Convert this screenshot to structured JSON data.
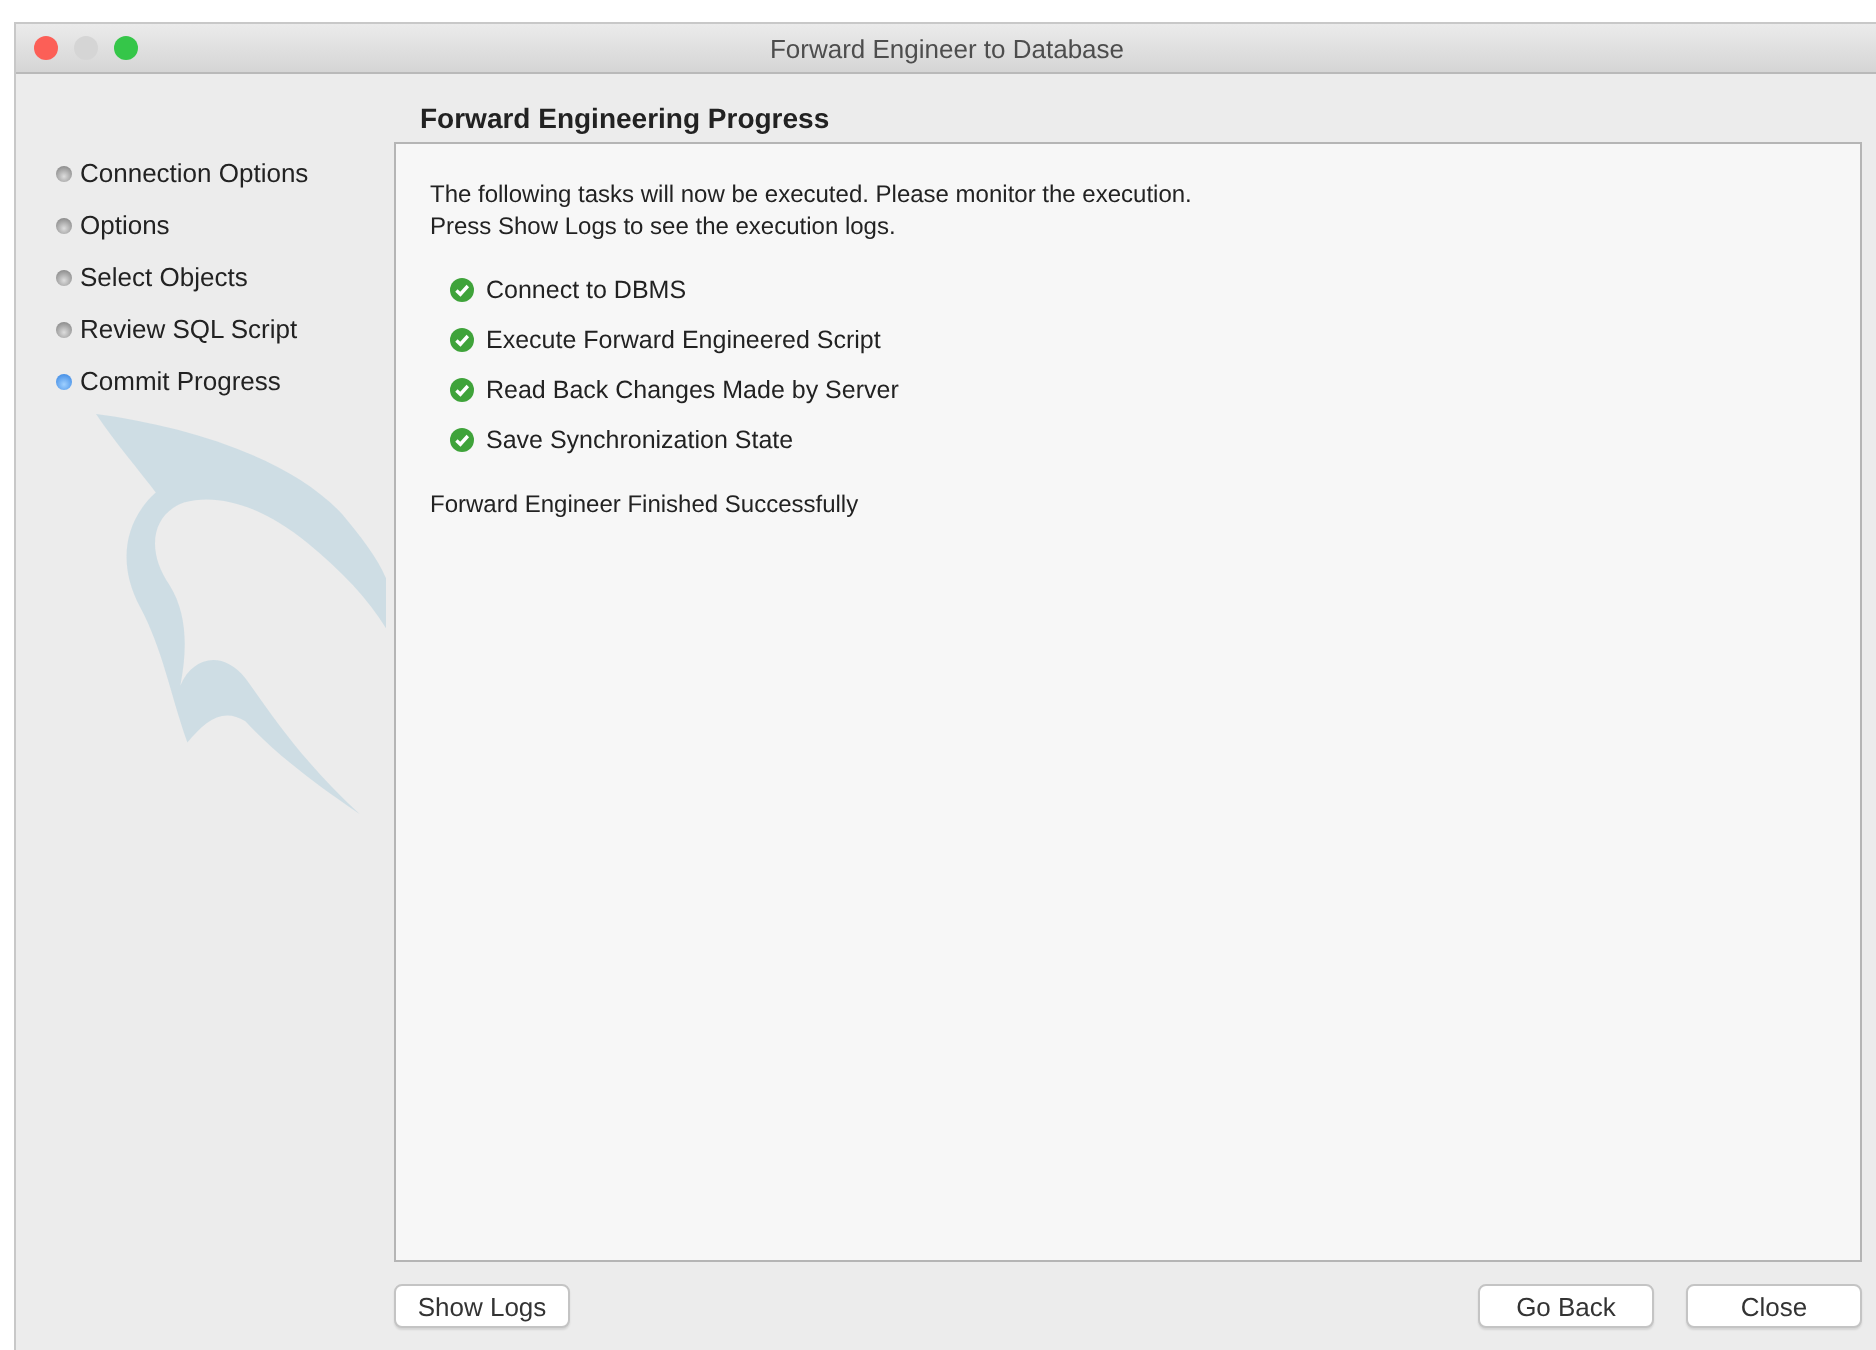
{
  "window": {
    "title": "Forward Engineer to Database"
  },
  "steps": [
    {
      "label": "Connection Options",
      "selected": false
    },
    {
      "label": "Options",
      "selected": false
    },
    {
      "label": "Select Objects",
      "selected": false
    },
    {
      "label": "Review SQL Script",
      "selected": false
    },
    {
      "label": "Commit Progress",
      "selected": true
    }
  ],
  "page": {
    "heading": "Forward Engineering Progress",
    "intro": [
      "The following tasks will now be executed. Please monitor the execution.",
      "Press Show Logs to see the execution logs."
    ],
    "tasks": [
      {
        "label": "Connect to DBMS",
        "done": true
      },
      {
        "label": "Execute Forward Engineered Script",
        "done": true
      },
      {
        "label": "Read Back Changes Made by Server",
        "done": true
      },
      {
        "label": "Save Synchronization State",
        "done": true
      }
    ],
    "result": "Forward Engineer Finished Successfully"
  },
  "buttons": {
    "left": [
      "Show Logs"
    ],
    "right": [
      "Go Back",
      "Close"
    ]
  }
}
